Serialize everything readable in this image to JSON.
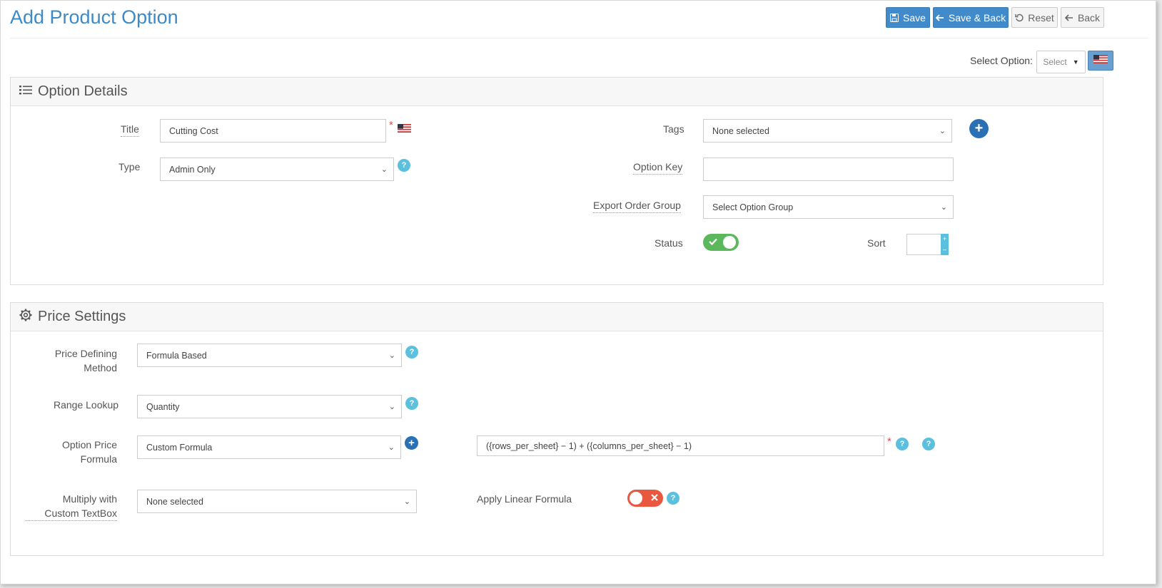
{
  "header": {
    "title": "Add Product Option",
    "buttons": {
      "save": "Save",
      "save_back": "Save & Back",
      "reset": "Reset",
      "back": "Back"
    }
  },
  "toolbar": {
    "select_option_label": "Select Option:",
    "select_option_value": "Select"
  },
  "option_details": {
    "heading": "Option Details",
    "title_label": "Title",
    "title_value": "Cutting Cost",
    "type_label": "Type",
    "type_value": "Admin Only",
    "tags_label": "Tags",
    "tags_value": "None selected",
    "option_key_label": "Option Key",
    "option_key_value": "",
    "export_group_label": "Export Order Group",
    "export_group_value": "Select Option Group",
    "status_label": "Status",
    "status_on": true,
    "sort_label": "Sort",
    "sort_value": ""
  },
  "price_settings": {
    "heading": "Price Settings",
    "price_method_label_1": "Price Defining",
    "price_method_label_2": "Method",
    "price_method_value": "Formula Based",
    "range_lookup_label": "Range Lookup",
    "range_lookup_value": "Quantity",
    "option_price_label_1": "Option Price",
    "option_price_label_2": "Formula",
    "option_price_value": "Custom Formula",
    "formula_value": "({rows_per_sheet} − 1) + ({columns_per_sheet} − 1)",
    "multiply_label_1": "Multiply with",
    "multiply_label_2": "Custom TextBox",
    "multiply_value": "None selected",
    "linear_label": "Apply Linear Formula",
    "linear_on": false
  },
  "colors": {
    "accent": "#428bca",
    "toggle_on": "#5cb85c",
    "toggle_off": "#e9573f",
    "help": "#5bc0de"
  }
}
